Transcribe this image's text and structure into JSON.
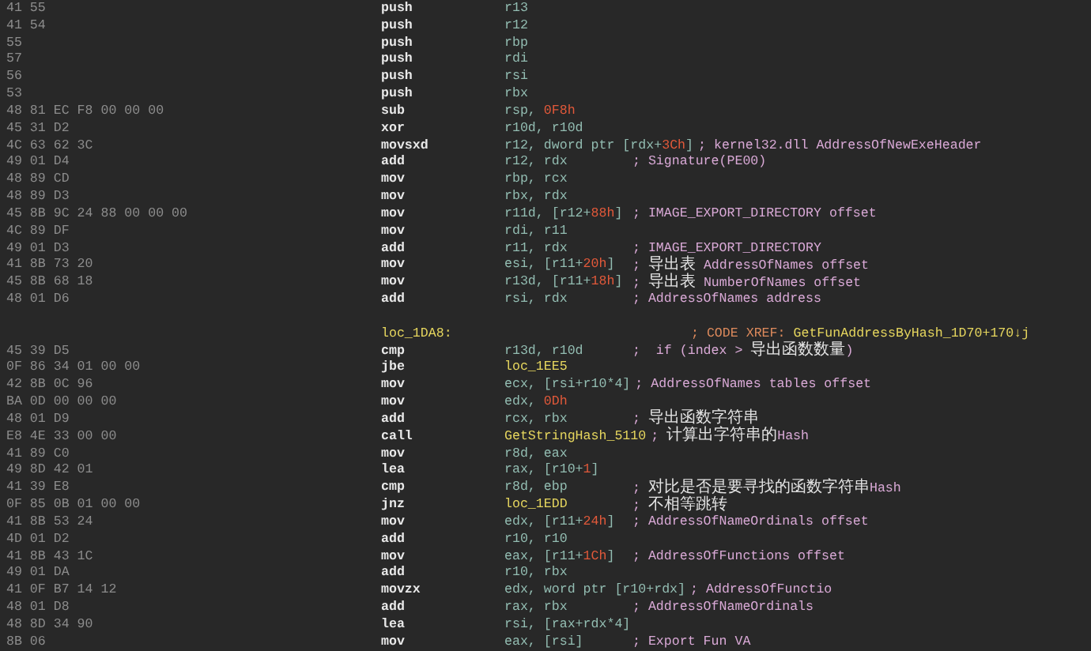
{
  "lines": [
    {
      "bytes": "41 55",
      "mnemonic": "push",
      "operand": [
        {
          "text": "r13",
          "kind": "reg"
        }
      ]
    },
    {
      "bytes": "41 54",
      "mnemonic": "push",
      "operand": [
        {
          "text": "r12",
          "kind": "reg"
        }
      ]
    },
    {
      "bytes": "55",
      "mnemonic": "push",
      "operand": [
        {
          "text": "rbp",
          "kind": "reg"
        }
      ]
    },
    {
      "bytes": "57",
      "mnemonic": "push",
      "operand": [
        {
          "text": "rdi",
          "kind": "reg"
        }
      ]
    },
    {
      "bytes": "56",
      "mnemonic": "push",
      "operand": [
        {
          "text": "rsi",
          "kind": "reg"
        }
      ]
    },
    {
      "bytes": "53",
      "mnemonic": "push",
      "operand": [
        {
          "text": "rbx",
          "kind": "reg"
        }
      ]
    },
    {
      "bytes": "48 81 EC F8 00 00 00",
      "mnemonic": "sub",
      "operand": [
        {
          "text": "rsp, ",
          "kind": "reg"
        },
        {
          "text": "0F8h",
          "kind": "num"
        }
      ]
    },
    {
      "bytes": "45 31 D2",
      "mnemonic": "xor",
      "operand": [
        {
          "text": "r10d, r10d",
          "kind": "reg"
        }
      ]
    },
    {
      "bytes": "4C 63 62 3C",
      "mnemonic": "movsxd",
      "operand": [
        {
          "text": "r12, dword ptr [rdx+",
          "kind": "reg"
        },
        {
          "text": "3Ch",
          "kind": "num"
        },
        {
          "text": "]",
          "kind": "reg"
        }
      ],
      "comment": "; kernel32.dll AddressOfNewExeHeader"
    },
    {
      "bytes": "49 01 D4",
      "mnemonic": "add",
      "operand": [
        {
          "text": "r12, rdx",
          "kind": "reg"
        }
      ],
      "comment": "; Signature(PE00)"
    },
    {
      "bytes": "48 89 CD",
      "mnemonic": "mov",
      "operand": [
        {
          "text": "rbp, rcx",
          "kind": "reg"
        }
      ]
    },
    {
      "bytes": "48 89 D3",
      "mnemonic": "mov",
      "operand": [
        {
          "text": "rbx, rdx",
          "kind": "reg"
        }
      ]
    },
    {
      "bytes": "45 8B 9C 24 88 00 00 00",
      "mnemonic": "mov",
      "operand": [
        {
          "text": "r11d, [r12+",
          "kind": "reg"
        },
        {
          "text": "88h",
          "kind": "num"
        },
        {
          "text": "]",
          "kind": "reg"
        }
      ],
      "comment": "; IMAGE_EXPORT_DIRECTORY offset"
    },
    {
      "bytes": "4C 89 DF",
      "mnemonic": "mov",
      "operand": [
        {
          "text": "rdi, r11",
          "kind": "reg"
        }
      ]
    },
    {
      "bytes": "49 01 D3",
      "mnemonic": "add",
      "operand": [
        {
          "text": "r11, rdx",
          "kind": "reg"
        }
      ],
      "comment": "; IMAGE_EXPORT_DIRECTORY"
    },
    {
      "bytes": "41 8B 73 20",
      "mnemonic": "mov",
      "operand": [
        {
          "text": "esi, [r11+",
          "kind": "reg"
        },
        {
          "text": "20h",
          "kind": "num"
        },
        {
          "text": "]",
          "kind": "reg"
        }
      ],
      "comment": "; 导出表 AddressOfNames offset"
    },
    {
      "bytes": "45 8B 68 18",
      "mnemonic": "mov",
      "operand": [
        {
          "text": "r13d, [r11+",
          "kind": "reg"
        },
        {
          "text": "18h",
          "kind": "num"
        },
        {
          "text": "]",
          "kind": "reg"
        }
      ],
      "comment": "; 导出表 NumberOfNames offset"
    },
    {
      "bytes": "48 01 D6",
      "mnemonic": "add",
      "operand": [
        {
          "text": "rsi, rdx",
          "kind": "reg"
        }
      ],
      "comment": "; AddressOfNames address"
    },
    {
      "label": "loc_1DA8:",
      "xref": "; CODE XREF: ",
      "xref_target": "GetFunAddressByHash_1D70+170↓j"
    },
    {
      "bytes": "45 39 D5",
      "mnemonic": "cmp",
      "operand": [
        {
          "text": "r13d, r10d",
          "kind": "reg"
        }
      ],
      "comment": ";  if (index > 导出函数数量)"
    },
    {
      "bytes": "0F 86 34 01 00 00",
      "mnemonic": "jbe",
      "operand": [
        {
          "text": "loc_1EE5",
          "kind": "label"
        }
      ]
    },
    {
      "bytes": "42 8B 0C 96",
      "mnemonic": "mov",
      "operand": [
        {
          "text": "ecx, [rsi+r10*4]",
          "kind": "reg"
        }
      ],
      "comment": "; AddressOfNames tables offset"
    },
    {
      "bytes": "BA 0D 00 00 00",
      "mnemonic": "mov",
      "operand": [
        {
          "text": "edx, ",
          "kind": "reg"
        },
        {
          "text": "0Dh",
          "kind": "num"
        }
      ]
    },
    {
      "bytes": "48 01 D9",
      "mnemonic": "add",
      "operand": [
        {
          "text": "rcx, rbx",
          "kind": "reg"
        }
      ],
      "comment": "; 导出函数字符串"
    },
    {
      "bytes": "E8 4E 33 00 00",
      "mnemonic": "call",
      "operand": [
        {
          "text": "GetStringHash_5110",
          "kind": "label"
        }
      ],
      "comment": "; 计算出字符串的Hash"
    },
    {
      "bytes": "41 89 C0",
      "mnemonic": "mov",
      "operand": [
        {
          "text": "r8d, eax",
          "kind": "reg"
        }
      ]
    },
    {
      "bytes": "49 8D 42 01",
      "mnemonic": "lea",
      "operand": [
        {
          "text": "rax, [r10+",
          "kind": "reg"
        },
        {
          "text": "1",
          "kind": "num"
        },
        {
          "text": "]",
          "kind": "reg"
        }
      ]
    },
    {
      "bytes": "41 39 E8",
      "mnemonic": "cmp",
      "operand": [
        {
          "text": "r8d, ebp",
          "kind": "reg"
        }
      ],
      "comment": "; 对比是否是要寻找的函数字符串Hash"
    },
    {
      "bytes": "0F 85 0B 01 00 00",
      "mnemonic": "jnz",
      "operand": [
        {
          "text": "loc_1EDD",
          "kind": "label"
        }
      ],
      "comment": "; 不相等跳转"
    },
    {
      "bytes": "41 8B 53 24",
      "mnemonic": "mov",
      "operand": [
        {
          "text": "edx, [r11+",
          "kind": "reg"
        },
        {
          "text": "24h",
          "kind": "num"
        },
        {
          "text": "]",
          "kind": "reg"
        }
      ],
      "comment": "; AddressOfNameOrdinals offset"
    },
    {
      "bytes": "4D 01 D2",
      "mnemonic": "add",
      "operand": [
        {
          "text": "r10, r10",
          "kind": "reg"
        }
      ]
    },
    {
      "bytes": "41 8B 43 1C",
      "mnemonic": "mov",
      "operand": [
        {
          "text": "eax, [r11+",
          "kind": "reg"
        },
        {
          "text": "1Ch",
          "kind": "num"
        },
        {
          "text": "]",
          "kind": "reg"
        }
      ],
      "comment": "; AddressOfFunctions offset"
    },
    {
      "bytes": "49 01 DA",
      "mnemonic": "add",
      "operand": [
        {
          "text": "r10, rbx",
          "kind": "reg"
        }
      ]
    },
    {
      "bytes": "41 0F B7 14 12",
      "mnemonic": "movzx",
      "operand": [
        {
          "text": "edx, word ptr [r10+rdx]",
          "kind": "reg"
        }
      ],
      "comment": "; AddressOfFunctio"
    },
    {
      "bytes": "48 01 D8",
      "mnemonic": "add",
      "operand": [
        {
          "text": "rax, rbx",
          "kind": "reg"
        }
      ],
      "comment": "; AddressOfNameOrdinals"
    },
    {
      "bytes": "48 8D 34 90",
      "mnemonic": "lea",
      "operand": [
        {
          "text": "rsi, [rax+rdx*4]",
          "kind": "reg"
        }
      ]
    },
    {
      "bytes": "8B 06",
      "mnemonic": "mov",
      "operand": [
        {
          "text": "eax, [rsi]",
          "kind": "reg"
        }
      ],
      "comment": "; Export Fun VA"
    }
  ]
}
